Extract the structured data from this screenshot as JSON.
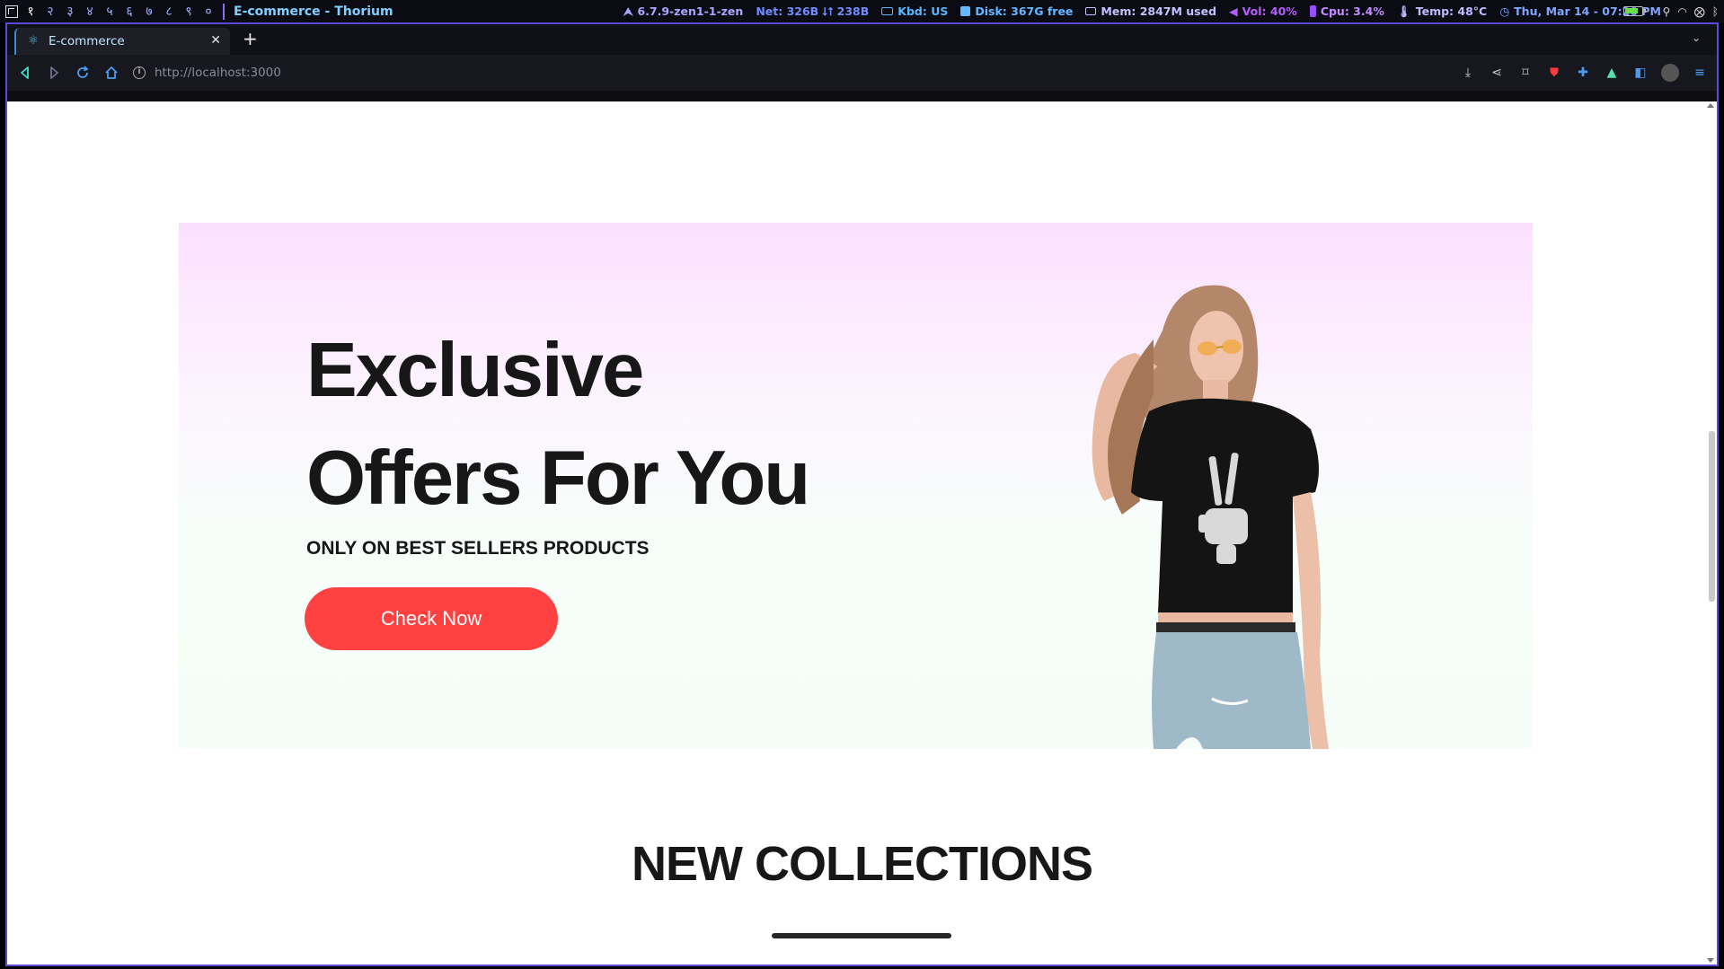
{
  "system_bar": {
    "workspaces": [
      "१",
      "२",
      "३",
      "४",
      "५",
      "६",
      "७",
      "८",
      "९",
      "०"
    ],
    "active_window": "E-commerce - Thorium",
    "stats": [
      {
        "icon": "kernel-icon",
        "text": "6.7.9-zen1-1-zen",
        "color": "#a9a6ff"
      },
      {
        "icon": "network-icon",
        "text": "Net: 326B ⭣⭡ 238B",
        "color": "#6f8cff"
      },
      {
        "icon": "keyboard-icon",
        "text": "Kbd: US",
        "color": "#58b6ff"
      },
      {
        "icon": "disk-icon",
        "text": "Disk: 367G free",
        "color": "#63b8ff"
      },
      {
        "icon": "memory-icon",
        "text": "Mem: 2847M used",
        "color": "#c2c2ff"
      },
      {
        "icon": "volume-icon",
        "text": "Vol: 40%",
        "color": "#b65cff"
      },
      {
        "icon": "cpu-icon",
        "text": "Cpu: 3.4%",
        "color": "#c28bff"
      },
      {
        "icon": "temperature-icon",
        "text": "Temp: 48°C",
        "color": "#c2b8ff"
      },
      {
        "icon": "clock-icon",
        "text": "Thu, Mar 14 - 07:20 PM",
        "color": "#7da6ff"
      }
    ]
  },
  "browser": {
    "tab": {
      "title": "E-commerce"
    },
    "url": "http://localhost:3000"
  },
  "hero": {
    "headline_line1": "Exclusive",
    "headline_line2": "Offers For You",
    "subheading": "ONLY ON BEST SELLERS PRODUCTS",
    "cta_label": "Check Now"
  },
  "collections": {
    "title": "NEW COLLECTIONS"
  },
  "colors": {
    "accent": "#ff4141",
    "frame": "#5b4bd8"
  }
}
